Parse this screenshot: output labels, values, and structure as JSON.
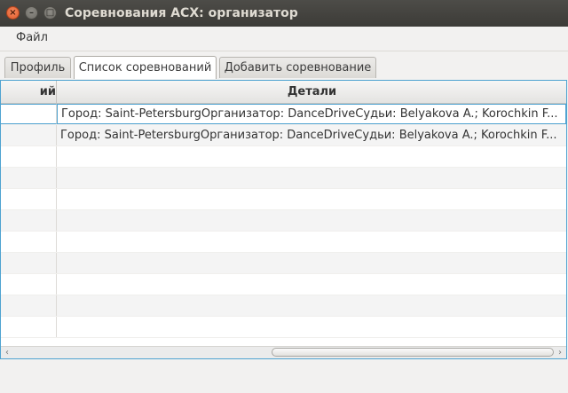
{
  "window": {
    "title": "Соревнования АСХ: организатор",
    "close_glyph": "×",
    "minimize_glyph": "–",
    "maximize_glyph": "□"
  },
  "menu": {
    "items": [
      {
        "label": "Файл"
      }
    ]
  },
  "tabs": [
    {
      "label": "Профиль",
      "active": false
    },
    {
      "label": "Список соревнований",
      "active": true
    },
    {
      "label": "Добавить соревнование",
      "active": false
    }
  ],
  "table": {
    "columns": [
      {
        "label": "ий"
      },
      {
        "label": "Детали"
      }
    ],
    "rows": [
      {
        "col1": "",
        "details": "Город: Saint-PetersburgОрганизатор: DanceDriveСудьи: Belyakova A.; Korochkin F..."
      },
      {
        "col1": "",
        "details": "Город: Saint-PetersburgОрганизатор: DanceDriveСудьи: Belyakova A.; Korochkin F..."
      },
      {
        "col1": "",
        "details": ""
      },
      {
        "col1": "",
        "details": ""
      },
      {
        "col1": "",
        "details": ""
      },
      {
        "col1": "",
        "details": ""
      },
      {
        "col1": "",
        "details": ""
      },
      {
        "col1": "",
        "details": ""
      },
      {
        "col1": "",
        "details": ""
      },
      {
        "col1": "",
        "details": ""
      },
      {
        "col1": "",
        "details": ""
      }
    ]
  },
  "scrollbar": {
    "left_arrow": "‹",
    "right_arrow": "›"
  }
}
